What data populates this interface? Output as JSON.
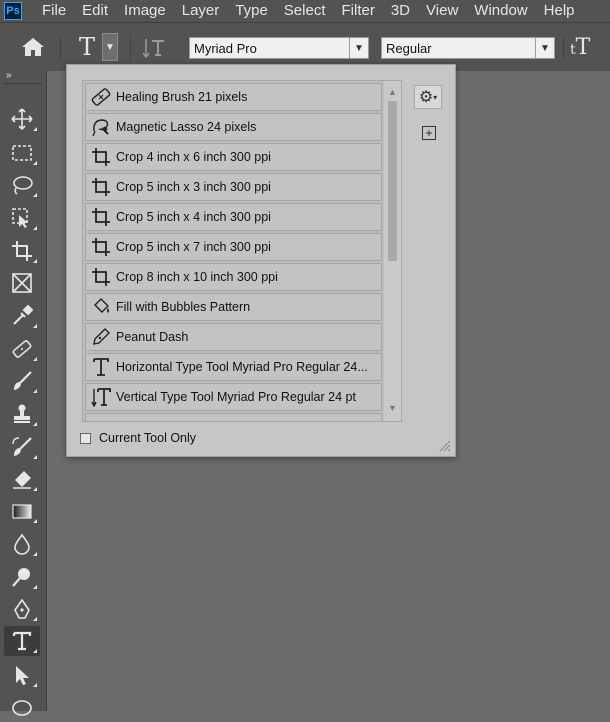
{
  "app": {
    "logo": "Ps"
  },
  "menu": [
    "File",
    "Edit",
    "Image",
    "Layer",
    "Type",
    "Select",
    "Filter",
    "3D",
    "View",
    "Window",
    "Help"
  ],
  "options_bar": {
    "tool_glyph": "T",
    "font_family": "Myriad Pro",
    "font_style": "Regular",
    "size_glyph": "tT"
  },
  "toolbar": {
    "collapse_glyph": "»",
    "tools": [
      {
        "name": "move-tool",
        "icon": "move-icon"
      },
      {
        "name": "marquee-tool",
        "icon": "rect-marquee-icon"
      },
      {
        "name": "lasso-tool",
        "icon": "lasso-icon"
      },
      {
        "name": "object-select-tool",
        "icon": "object-select-icon"
      },
      {
        "name": "crop-tool",
        "icon": "crop-icon"
      },
      {
        "name": "frame-tool",
        "icon": "frame-icon"
      },
      {
        "name": "eyedropper-tool",
        "icon": "eyedropper-icon"
      },
      {
        "name": "healing-brush-tool",
        "icon": "bandage-icon"
      },
      {
        "name": "brush-tool",
        "icon": "brush-icon"
      },
      {
        "name": "stamp-tool",
        "icon": "stamp-icon"
      },
      {
        "name": "history-brush-tool",
        "icon": "history-brush-icon"
      },
      {
        "name": "eraser-tool",
        "icon": "eraser-icon"
      },
      {
        "name": "gradient-tool",
        "icon": "gradient-icon"
      },
      {
        "name": "blur-tool",
        "icon": "drop-icon"
      },
      {
        "name": "dodge-tool",
        "icon": "dodge-icon"
      },
      {
        "name": "pen-tool",
        "icon": "pen-icon"
      },
      {
        "name": "type-tool",
        "icon": "type-icon",
        "active": true
      },
      {
        "name": "path-select-tool",
        "icon": "arrow-icon"
      },
      {
        "name": "shape-tool",
        "icon": "ellipse-icon"
      }
    ]
  },
  "presets": {
    "items": [
      {
        "label": "Healing Brush 21 pixels",
        "icon": "bandage-icon"
      },
      {
        "label": "Magnetic Lasso 24 pixels",
        "icon": "magnetic-lasso-icon"
      },
      {
        "label": "Crop 4 inch x 6 inch 300 ppi",
        "icon": "crop-icon"
      },
      {
        "label": "Crop 5 inch x 3 inch 300 ppi",
        "icon": "crop-icon"
      },
      {
        "label": "Crop 5 inch x 4 inch 300 ppi",
        "icon": "crop-icon"
      },
      {
        "label": "Crop 5 inch x 7 inch 300 ppi",
        "icon": "crop-icon"
      },
      {
        "label": "Crop 8 inch x 10 inch 300 ppi",
        "icon": "crop-icon"
      },
      {
        "label": "Fill with Bubbles Pattern",
        "icon": "paint-bucket-icon"
      },
      {
        "label": "Peanut Dash",
        "icon": "pen-icon"
      },
      {
        "label": "Horizontal Type Tool Myriad Pro Regular 24...",
        "icon": "type-icon"
      },
      {
        "label": "Vertical Type Tool Myriad Pro Regular 24 pt",
        "icon": "vertical-type-icon"
      }
    ],
    "current_tool_only_label": "Current Tool Only",
    "current_tool_only_checked": false
  }
}
